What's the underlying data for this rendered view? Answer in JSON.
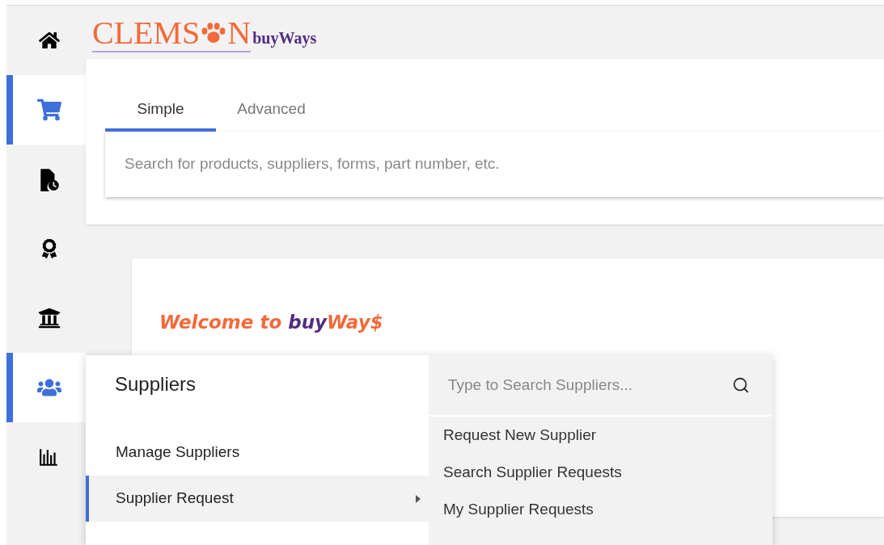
{
  "logo": {
    "left": "CLEMS",
    "right": "N",
    "suffix": "buyWays"
  },
  "sidebar": {
    "items": [
      {
        "selected": false
      },
      {
        "selected": true
      },
      {
        "selected": false
      },
      {
        "selected": false
      },
      {
        "selected": false
      },
      {
        "selected": true
      },
      {
        "selected": false
      }
    ]
  },
  "search_tabs": [
    {
      "label": "Simple",
      "selected": true
    },
    {
      "label": "Advanced",
      "selected": false
    }
  ],
  "search": {
    "placeholder": "Search for products, suppliers, forms, part number, etc."
  },
  "welcome": [
    {
      "text": "Welcome to ",
      "color": "#f26a3a"
    },
    {
      "text": "buy",
      "color": "#522d80"
    },
    {
      "text": "Way$",
      "color": "#f26a3a"
    }
  ],
  "flyout": {
    "title": "Suppliers",
    "items": [
      {
        "label": "Manage Suppliers",
        "selected": false,
        "has_submenu": false
      },
      {
        "label": "Supplier Request",
        "selected": true,
        "has_submenu": true
      }
    ]
  },
  "submenu": {
    "search": {
      "placeholder": "Type to Search Suppliers..."
    },
    "items": [
      "Request New Supplier",
      "Search Supplier Requests",
      "My Supplier Requests"
    ]
  }
}
